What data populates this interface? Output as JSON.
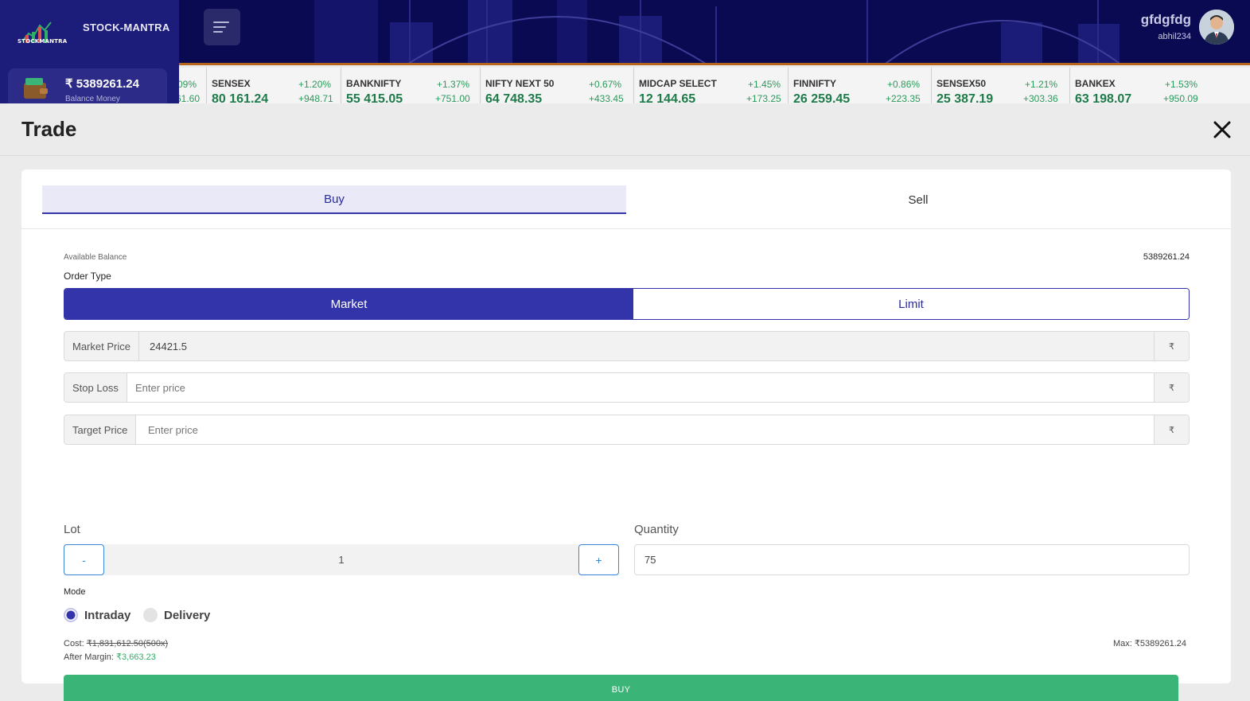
{
  "header": {
    "brand": "STOCK-MANTRA",
    "logo_text": "STOCKMANTRA",
    "balance_value": "₹ 5389261.24",
    "balance_label": "Balance Money",
    "username": "gfdgfdg",
    "user_id": "abhil234",
    "accent_color": "#3434aa"
  },
  "ticker": [
    {
      "name": "",
      "value": "",
      "pct": "09%",
      "change": "61.60"
    },
    {
      "name": "SENSEX",
      "value": "80 161.24",
      "pct": "+1.20%",
      "change": "+948.71"
    },
    {
      "name": "BANKNIFTY",
      "value": "55 415.05",
      "pct": "+1.37%",
      "change": "+751.00"
    },
    {
      "name": "NIFTY NEXT 50",
      "value": "64 748.35",
      "pct": "+0.67%",
      "change": "+433.45"
    },
    {
      "name": "MIDCAP SELECT",
      "value": "12 144.65",
      "pct": "+1.45%",
      "change": "+173.25"
    },
    {
      "name": "FINNIFTY",
      "value": "26 259.45",
      "pct": "+0.86%",
      "change": "+223.35"
    },
    {
      "name": "SENSEX50",
      "value": "25 387.19",
      "pct": "+1.21%",
      "change": "+303.36"
    },
    {
      "name": "BANKEX",
      "value": "63 198.07",
      "pct": "+1.53%",
      "change": "+950.09"
    }
  ],
  "modal": {
    "title": "Trade",
    "tabs": {
      "buy": "Buy",
      "sell": "Sell"
    },
    "available_balance_label": "Available Balance",
    "available_balance_value": "5389261.24",
    "order_type_label": "Order Type",
    "order_types": {
      "market": "Market",
      "limit": "Limit"
    },
    "market_price": {
      "label": "Market Price",
      "value": "24421.5",
      "currency": "₹"
    },
    "stop_loss": {
      "label": "Stop Loss",
      "placeholder": "Enter price",
      "currency": "₹"
    },
    "target_price": {
      "label": "Target Price",
      "placeholder": "Enter price",
      "currency": "₹"
    },
    "lot": {
      "label": "Lot",
      "minus": "-",
      "plus": "+",
      "value": "1"
    },
    "quantity": {
      "label": "Quantity",
      "value": "75"
    },
    "mode": {
      "label": "Mode",
      "intraday": "Intraday",
      "delivery": "Delivery",
      "selected": "Intraday"
    },
    "cost_label": "Cost:",
    "cost_value": "₹1,831,612.50(500x)",
    "after_margin_label": "After Margin:",
    "after_margin_value": "₹3,663.23",
    "max_label": "Max: ₹5389261.24",
    "buy_button": "BUY",
    "buy_color": "#3ab577"
  }
}
